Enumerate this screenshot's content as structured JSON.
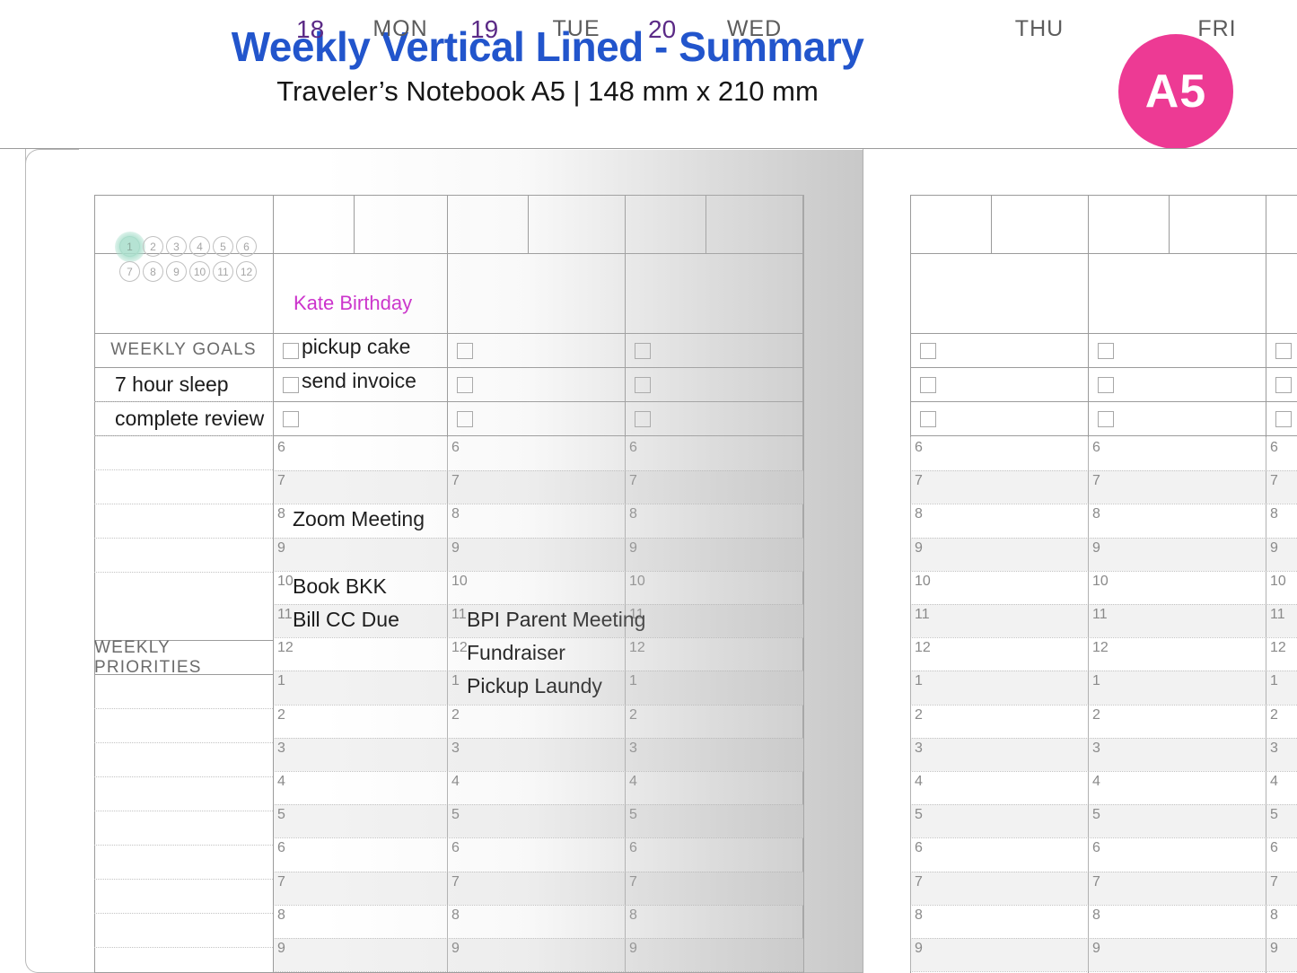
{
  "header": {
    "title": "Weekly Vertical Lined - Summary",
    "subtitle": "Traveler’s Notebook A5 | 148 mm x 210 mm",
    "badge": "A5",
    "brand_color": "#ED3A94",
    "title_color": "#2255cc"
  },
  "months": {
    "row1": [
      "1",
      "2",
      "3",
      "4",
      "5",
      "6"
    ],
    "row2": [
      "7",
      "8",
      "9",
      "10",
      "11",
      "12"
    ],
    "active": "1",
    "highlight_color": "#A8DECB"
  },
  "sidebar": {
    "goals_header": "WEEKLY GOALS",
    "goals": [
      "7 hour sleep",
      "complete review",
      "",
      "",
      "",
      "",
      ""
    ],
    "priorities_header": "WEEKLY PRIORITIES",
    "priorities": [
      "",
      "",
      "",
      "",
      "",
      "",
      "",
      "",
      ""
    ]
  },
  "left_page": {
    "days": [
      {
        "date": "18",
        "name": "MON",
        "allday": "Kate Birthday",
        "tasks": [
          "pickup cake",
          "send invoice",
          ""
        ]
      },
      {
        "date": "19",
        "name": "TUE",
        "allday": "",
        "tasks": [
          "",
          "",
          ""
        ]
      },
      {
        "date": "20",
        "name": "WED",
        "allday": "",
        "tasks": [
          "",
          "",
          ""
        ]
      }
    ],
    "date_color": "#5b2a86",
    "dayname_color": "#5c5c5c",
    "allday_color": "#CC33CC"
  },
  "right_page": {
    "days": [
      {
        "date": "",
        "name": "THU",
        "allday": "",
        "tasks": [
          "",
          "",
          ""
        ]
      },
      {
        "date": "",
        "name": "FRI",
        "allday": "",
        "tasks": [
          "",
          "",
          ""
        ]
      },
      {
        "date": "",
        "name": "",
        "allday": "",
        "tasks": [
          "",
          "",
          ""
        ]
      }
    ]
  },
  "hours": [
    "6",
    "7",
    "8",
    "9",
    "10",
    "11",
    "12",
    "1",
    "2",
    "3",
    "4",
    "5",
    "6",
    "7",
    "8",
    "9"
  ],
  "events": {
    "mon": [
      {
        "hour": "8",
        "text": "Zoom Meeting"
      },
      {
        "hour": "10",
        "text": "Book BKK"
      },
      {
        "hour": "11",
        "text": "Bill CC Due"
      }
    ],
    "tue": [
      {
        "hour": "11",
        "text": "BPI Parent Meeting"
      },
      {
        "hour": "12",
        "text": "Fundraiser"
      },
      {
        "hour": "1",
        "text": "Pickup Laundy"
      }
    ],
    "wed": []
  }
}
